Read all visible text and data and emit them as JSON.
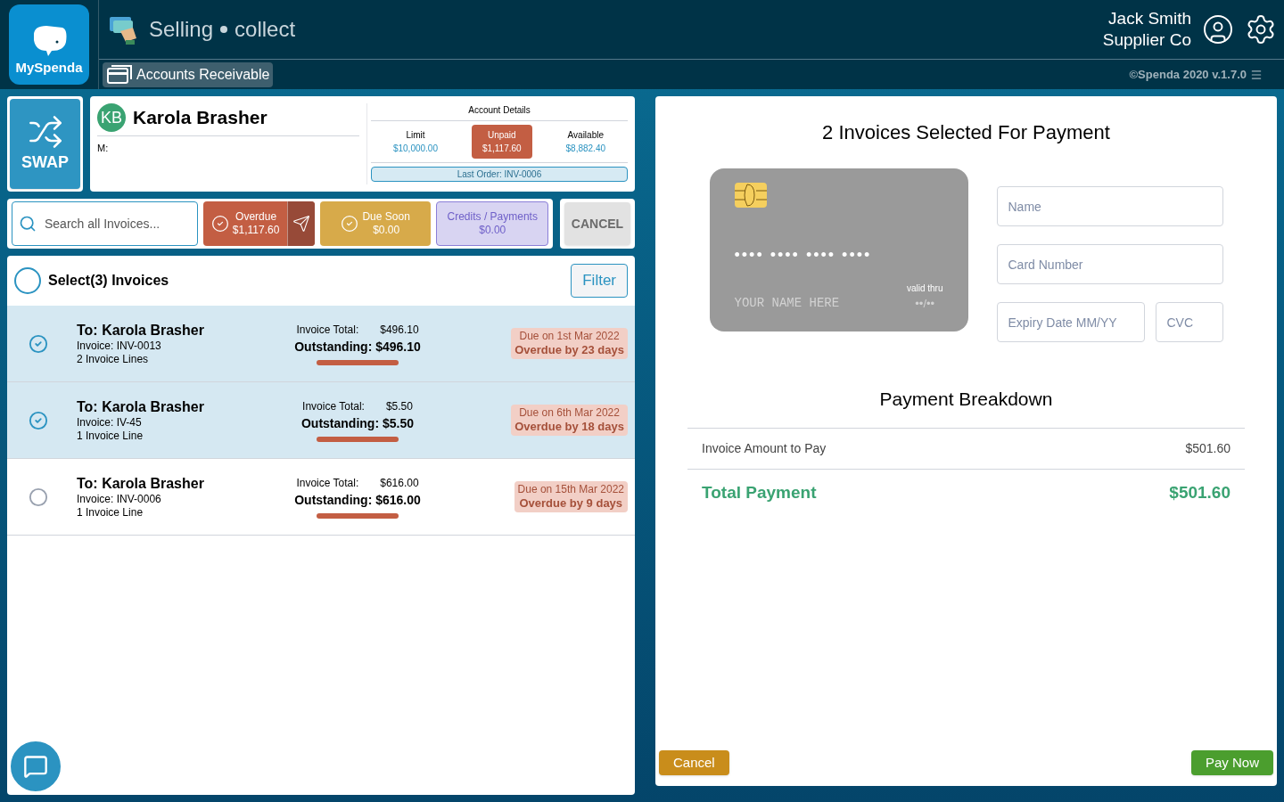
{
  "app": {
    "logo_text": "MySpenda",
    "module_left": "Selling",
    "module_right": "collect",
    "nav_tab": {
      "label": "Accounts Receivable",
      "selected": true
    }
  },
  "user": {
    "name": "Jack Smith",
    "company": "Supplier Co",
    "version": "©Spenda 2020 v.1.7.0"
  },
  "swap": {
    "label": "SWAP"
  },
  "customer": {
    "initials": "KB",
    "name": "Karola Brasher",
    "mobile_label": "M:"
  },
  "account_details": {
    "title": "Account Details",
    "items": [
      {
        "label": "Limit",
        "value": "$10,000.00",
        "highlighted": false
      },
      {
        "label": "Unpaid",
        "value": "$1,117.60",
        "highlighted": true
      },
      {
        "label": "Available",
        "value": "$8,882.40",
        "highlighted": false
      }
    ],
    "last_order": "Last Order: INV-0006"
  },
  "search": {
    "placeholder": "Search all Invoices..."
  },
  "filters": [
    {
      "kind": "overdue",
      "label": "Overdue",
      "amount": "$1,117.60",
      "checked": true
    },
    {
      "kind": "due_soon",
      "label": "Due Soon",
      "amount": "$0.00",
      "checked": true
    },
    {
      "kind": "credits",
      "label": "Credits / Payments",
      "amount": "$0.00",
      "checked": false
    }
  ],
  "cancel_top": {
    "label": "CANCEL",
    "disabled": true
  },
  "list_header": {
    "label": "Select(3) Invoices",
    "checked": false,
    "filter_button": "Filter"
  },
  "invoices": [
    {
      "to": "To: Karola Brasher",
      "invoice": "Invoice: INV-0013",
      "lines": "2 Invoice Lines",
      "total_label": "Invoice Total:",
      "total": "$496.10",
      "outstanding": "Outstanding: $496.10",
      "due": "Due on 1st Mar 2022",
      "overdue": "Overdue by 23 days",
      "selected": true
    },
    {
      "to": "To: Karola Brasher",
      "invoice": "Invoice: IV-45",
      "lines": "1 Invoice Line",
      "total_label": "Invoice Total:",
      "total": "$5.50",
      "outstanding": "Outstanding: $5.50",
      "due": "Due on 6th Mar 2022",
      "overdue": "Overdue by 18 days",
      "selected": true
    },
    {
      "to": "To: Karola Brasher",
      "invoice": "Invoice: INV-0006",
      "lines": "1 Invoice Line",
      "total_label": "Invoice Total:",
      "total": "$616.00",
      "outstanding": "Outstanding: $616.00",
      "due": "Due on 15th Mar 2022",
      "overdue": "Overdue by 9 days",
      "selected": false
    }
  ],
  "payment": {
    "title": "2 Invoices Selected For Payment",
    "card": {
      "number": "•••• •••• •••• ••••",
      "name": "YOUR NAME HERE",
      "valid_label": "valid thru",
      "expiry": "••/••"
    },
    "fields": {
      "name": {
        "placeholder": "Name"
      },
      "card_number": {
        "placeholder": "Card Number"
      },
      "expiry": {
        "placeholder": "Expiry Date MM/YY"
      },
      "cvc": {
        "placeholder": "CVC"
      }
    },
    "breakdown_title": "Payment Breakdown",
    "rows": [
      {
        "label": "Invoice Amount to Pay",
        "value": "$501.60"
      }
    ],
    "total": {
      "label": "Total Payment",
      "value": "$501.60"
    },
    "cancel": "Cancel",
    "pay": "Pay Now"
  }
}
